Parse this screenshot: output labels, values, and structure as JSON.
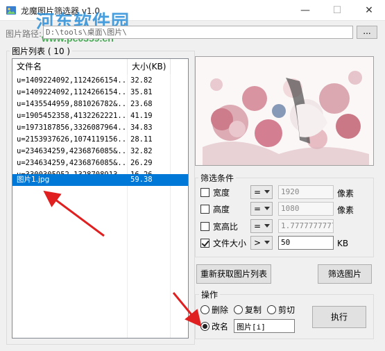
{
  "window": {
    "title": "龙魔图片筛选器 v1.0",
    "minimize_glyph": "—",
    "maximize_glyph": "☐",
    "close_glyph": "✕"
  },
  "watermark": {
    "text": "河东软件园",
    "url": "www.pc0359.cn"
  },
  "path_bar": {
    "label": "图片路径:",
    "value": "D:\\tools\\桌面\\图片\\",
    "browse_label": "..."
  },
  "image_list": {
    "group_title": "图片列表 ( 10 )",
    "columns": [
      "文件名",
      "大小(KB)"
    ],
    "rows": [
      {
        "name": "u=1409224092,1124266154...",
        "size": "32.82"
      },
      {
        "name": "u=1409224092,1124266154...",
        "size": "35.81"
      },
      {
        "name": "u=1435544959,881026782&...",
        "size": "23.68"
      },
      {
        "name": "u=1905452358,4132262221...",
        "size": "41.19"
      },
      {
        "name": "u=1973187856,3326087964...",
        "size": "34.83"
      },
      {
        "name": "u=2153937626,1074119156...",
        "size": "28.11"
      },
      {
        "name": "u=234634259,4236876085&...",
        "size": "32.82"
      },
      {
        "name": "u=234634259,4236876085&...",
        "size": "26.29"
      },
      {
        "name": "u=3300305952,1328708913...",
        "size": "16.26"
      },
      {
        "name": "图片1.jpg",
        "size": "59.38",
        "selected": true
      }
    ]
  },
  "filter": {
    "group_title": "筛选条件",
    "width": {
      "label": "宽度",
      "checked": false,
      "op": "=",
      "value": "1920",
      "unit": "像素"
    },
    "height": {
      "label": "高度",
      "checked": false,
      "op": "=",
      "value": "1080",
      "unit": "像素"
    },
    "ratio": {
      "label": "宽高比",
      "checked": false,
      "op": "=",
      "value": "1.7777777777"
    },
    "filesize": {
      "label": "文件大小",
      "checked": true,
      "op": ">",
      "value": "50",
      "unit": "KB"
    }
  },
  "buttons": {
    "reload": "重新获取图片列表",
    "filter": "筛选图片",
    "execute": "执行"
  },
  "operations": {
    "group_title": "操作",
    "delete": "删除",
    "copy": "复制",
    "cut": "剪切",
    "rename": "改名",
    "selected": "rename",
    "rename_value": "图片[i]"
  },
  "colors": {
    "selection": "#0078d7",
    "arrow": "#e02020",
    "watermark_text": "#2a8fd8",
    "watermark_url": "#2a9f3a"
  }
}
